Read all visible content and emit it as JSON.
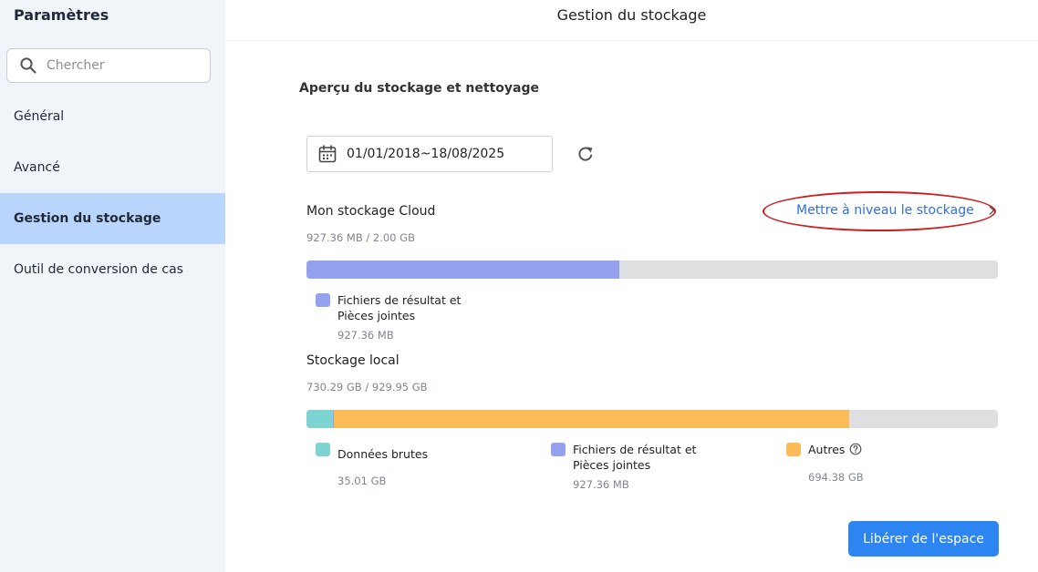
{
  "sidebar": {
    "title": "Paramètres",
    "search_placeholder": "Chercher",
    "items": [
      {
        "label": "Général"
      },
      {
        "label": "Avancé"
      },
      {
        "label": "Gestion du stockage"
      },
      {
        "label": "Outil de conversion de cas"
      }
    ],
    "active_item": "Gestion du stockage"
  },
  "header": {
    "title": "Gestion du stockage"
  },
  "main": {
    "section_title": "Aperçu du stockage et nettoyage",
    "date_range": "01/01/2018~18/08/2025",
    "cloud": {
      "title": "Mon stockage Cloud",
      "usage": "927.36 MB / 2.00 GB",
      "upgrade_label": "Mettre à niveau le stockage",
      "used_fraction": 0.453,
      "legend": [
        {
          "label_line1": "Fichiers de résultat et",
          "label_line2": "Pièces jointes",
          "value": "927.36 MB",
          "color": "#93a1ee"
        }
      ]
    },
    "local": {
      "title": "Stockage local",
      "usage": "730.29 GB / 929.95 GB",
      "segments": [
        {
          "name": "Données brutes",
          "fraction": 0.038,
          "color": "#7ed3d3"
        },
        {
          "name": "Fichiers de résultat et Pièces jointes",
          "fraction": 0.001,
          "color": "#93a1ee"
        },
        {
          "name": "Autres",
          "fraction": 0.746,
          "color": "#fbbb58"
        }
      ],
      "legend": [
        {
          "label": "Données brutes",
          "value": "35.01 GB",
          "color": "#7ed3d3"
        },
        {
          "label_line1": "Fichiers de résultat et",
          "label_line2": "Pièces jointes",
          "value": "927.36 MB",
          "color": "#93a1ee"
        },
        {
          "label": "Autres",
          "value": "694.38 GB",
          "color": "#fbbb58"
        }
      ]
    },
    "free_button": "Libérer de l'espace"
  }
}
